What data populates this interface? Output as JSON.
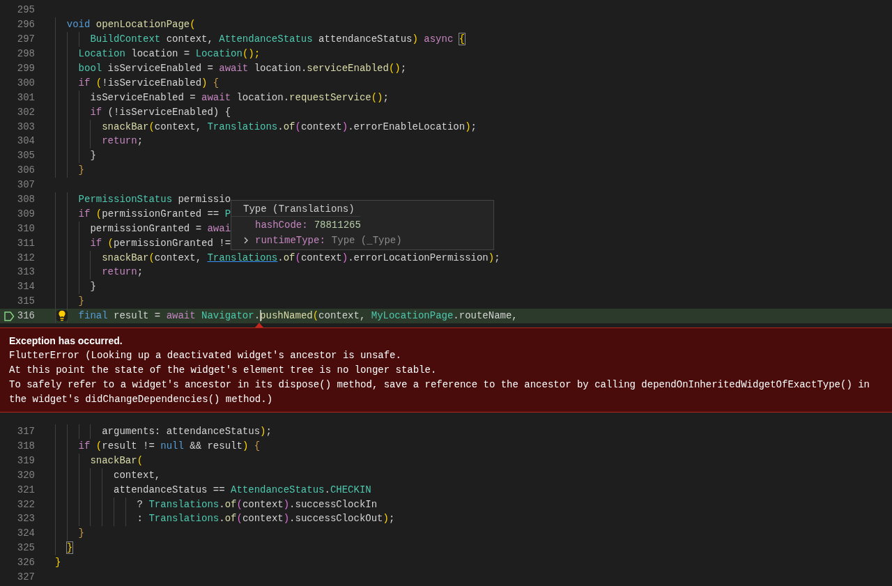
{
  "editor": {
    "lines_before": [
      {
        "number": "295"
      },
      {
        "number": "296",
        "tokens": [
          {
            "text": "  void",
            "kind": "kw"
          },
          {
            "text": " openLocationPage",
            "kind": "fn"
          },
          {
            "text": "(",
            "kind": "gold"
          }
        ]
      },
      {
        "number": "297",
        "tokens": [
          {
            "text": "      BuildContext",
            "kind": "type"
          },
          {
            "text": " context, ",
            "kind": "plain"
          },
          {
            "text": "AttendanceStatus",
            "kind": "type"
          },
          {
            "text": " attendanceStatus",
            "kind": "plain"
          },
          {
            "text": ")",
            "kind": "gold"
          },
          {
            "text": " async",
            "kind": "ctrl"
          },
          {
            "text": " {",
            "kind": "match"
          }
        ]
      },
      {
        "number": "298",
        "tokens": [
          {
            "text": "    Location",
            "kind": "type"
          },
          {
            "text": " location = ",
            "kind": "plain"
          },
          {
            "text": "Location",
            "kind": "type"
          },
          {
            "text": "();",
            "kind": "gold"
          }
        ]
      },
      {
        "number": "299",
        "tokens": [
          {
            "text": "    bool",
            "kind": "type"
          },
          {
            "text": " isServiceEnabled = ",
            "kind": "plain"
          },
          {
            "text": "await",
            "kind": "ctrl"
          },
          {
            "text": " location.",
            "kind": "plain"
          },
          {
            "text": "serviceEnabled",
            "kind": "fn"
          },
          {
            "text": "()",
            "kind": "gold"
          },
          {
            "text": ";",
            "kind": "plain"
          }
        ]
      },
      {
        "number": "300",
        "tokens": [
          {
            "text": "    if",
            "kind": "ctrl"
          },
          {
            "text": " (",
            "kind": "gold"
          },
          {
            "text": "!isServiceEnabled",
            "kind": "plain"
          },
          {
            "text": ")",
            "kind": "gold"
          },
          {
            "text": " {",
            "kind": "dimgold"
          }
        ]
      },
      {
        "number": "301",
        "tokens": [
          {
            "text": "      isServiceEnabled = ",
            "kind": "plain"
          },
          {
            "text": "await",
            "kind": "ctrl"
          },
          {
            "text": " location.",
            "kind": "plain"
          },
          {
            "text": "requestService",
            "kind": "fn"
          },
          {
            "text": "()",
            "kind": "gold"
          },
          {
            "text": ";",
            "kind": "plain"
          }
        ]
      },
      {
        "number": "302",
        "tokens": [
          {
            "text": "      if",
            "kind": "ctrl"
          },
          {
            "text": " (!isServiceEnabled) {",
            "kind": "plain"
          }
        ]
      },
      {
        "number": "303",
        "tokens": [
          {
            "text": "        snackBar",
            "kind": "fn"
          },
          {
            "text": "(",
            "kind": "gold"
          },
          {
            "text": "context, ",
            "kind": "plain"
          },
          {
            "text": "Translations",
            "kind": "type"
          },
          {
            "text": ".",
            "kind": "plain"
          },
          {
            "text": "of",
            "kind": "fn"
          },
          {
            "text": "(",
            "kind": "pink"
          },
          {
            "text": "context",
            "kind": "plain"
          },
          {
            "text": ")",
            "kind": "pink"
          },
          {
            "text": ".errorEnableLocation",
            "kind": "plain"
          },
          {
            "text": ")",
            "kind": "gold"
          },
          {
            "text": ";",
            "kind": "plain"
          }
        ]
      },
      {
        "number": "304",
        "tokens": [
          {
            "text": "        return",
            "kind": "ctrl"
          },
          {
            "text": ";",
            "kind": "plain"
          }
        ]
      },
      {
        "number": "305",
        "tokens": [
          {
            "text": "      }",
            "kind": "plain"
          }
        ]
      },
      {
        "number": "306",
        "tokens": [
          {
            "text": "    }",
            "kind": "dimgold"
          }
        ]
      },
      {
        "number": "307"
      },
      {
        "number": "308",
        "tokens": [
          {
            "text": "    PermissionStatus",
            "kind": "type"
          },
          {
            "text": " permissio",
            "kind": "plain"
          }
        ]
      },
      {
        "number": "309",
        "tokens": [
          {
            "text": "    if",
            "kind": "ctrl"
          },
          {
            "text": " (",
            "kind": "gold"
          },
          {
            "text": "permissionGranted == ",
            "kind": "plain"
          },
          {
            "text": "P",
            "kind": "type"
          }
        ]
      },
      {
        "number": "310",
        "tokens": [
          {
            "text": "      permissionGranted = ",
            "kind": "plain"
          },
          {
            "text": "awai",
            "kind": "ctrl"
          }
        ]
      },
      {
        "number": "311",
        "tokens": [
          {
            "text": "      if",
            "kind": "ctrl"
          },
          {
            "text": " (",
            "kind": "gold"
          },
          {
            "text": "permissionGranted !=",
            "kind": "plain"
          }
        ]
      },
      {
        "number": "312",
        "tokens": [
          {
            "text": "        snackBar",
            "kind": "fn"
          },
          {
            "text": "(",
            "kind": "gold"
          },
          {
            "text": "context, ",
            "kind": "plain"
          },
          {
            "text": "Translations",
            "kind": "link"
          },
          {
            "text": ".",
            "kind": "plain"
          },
          {
            "text": "of",
            "kind": "fn"
          },
          {
            "text": "(",
            "kind": "pink"
          },
          {
            "text": "context",
            "kind": "plain"
          },
          {
            "text": ")",
            "kind": "pink"
          },
          {
            "text": ".errorLocationPermission",
            "kind": "plain"
          },
          {
            "text": ")",
            "kind": "gold"
          },
          {
            "text": ";",
            "kind": "plain"
          }
        ]
      },
      {
        "number": "313",
        "tokens": [
          {
            "text": "        return",
            "kind": "ctrl"
          },
          {
            "text": ";",
            "kind": "plain"
          }
        ]
      },
      {
        "number": "314",
        "tokens": [
          {
            "text": "      }",
            "kind": "plain"
          }
        ]
      },
      {
        "number": "315",
        "tokens": [
          {
            "text": "    }",
            "kind": "dimgold"
          }
        ]
      }
    ],
    "paused_line": {
      "number": "316",
      "tokens": [
        {
          "text": "    final",
          "kind": "kw",
          "caret": false
        },
        {
          "text": " result = ",
          "kind": "plain",
          "caret": false
        },
        {
          "text": "await",
          "kind": "ctrl",
          "caret": false
        },
        {
          "text": " Navigator",
          "kind": "type",
          "caret": false
        },
        {
          "text": ".",
          "kind": "plain",
          "caret": true
        },
        {
          "text": "pushNamed",
          "kind": "fn",
          "caret": false
        },
        {
          "text": "(",
          "kind": "gold",
          "caret": false
        },
        {
          "text": "context, ",
          "kind": "plain",
          "caret": false
        },
        {
          "text": "MyLocationPage",
          "kind": "type",
          "caret": false
        },
        {
          "text": ".routeName,",
          "kind": "plain",
          "caret": false
        }
      ]
    },
    "exception": {
      "title": "Exception has occurred.",
      "message_lines": [
        "FlutterError (Looking up a deactivated widget's ancestor is unsafe.",
        "At this point the state of the widget's element tree is no longer stable.",
        "To safely refer to a widget's ancestor in its dispose() method, save a reference to the ancestor by calling dependOnInheritedWidgetOfExactType() in",
        "the widget's didChangeDependencies() method.)"
      ]
    },
    "lines_after": [
      {
        "number": "317",
        "tokens": [
          {
            "text": "        arguments: attendanceStatus",
            "kind": "plain"
          },
          {
            "text": ")",
            "kind": "gold"
          },
          {
            "text": ";",
            "kind": "plain"
          }
        ]
      },
      {
        "number": "318",
        "tokens": [
          {
            "text": "    if",
            "kind": "ctrl"
          },
          {
            "text": " (",
            "kind": "gold"
          },
          {
            "text": "result != ",
            "kind": "plain"
          },
          {
            "text": "null",
            "kind": "kw"
          },
          {
            "text": " && result",
            "kind": "plain"
          },
          {
            "text": ")",
            "kind": "gold"
          },
          {
            "text": " {",
            "kind": "dimgold"
          }
        ]
      },
      {
        "number": "319",
        "tokens": [
          {
            "text": "      snackBar",
            "kind": "fn"
          },
          {
            "text": "(",
            "kind": "gold"
          }
        ]
      },
      {
        "number": "320",
        "tokens": [
          {
            "text": "          context,",
            "kind": "plain"
          }
        ]
      },
      {
        "number": "321",
        "tokens": [
          {
            "text": "          attendanceStatus == ",
            "kind": "plain"
          },
          {
            "text": "AttendanceStatus",
            "kind": "type"
          },
          {
            "text": ".",
            "kind": "plain"
          },
          {
            "text": "CHECKIN",
            "kind": "type"
          }
        ]
      },
      {
        "number": "322",
        "tokens": [
          {
            "text": "              ? ",
            "kind": "plain"
          },
          {
            "text": "Translations",
            "kind": "type"
          },
          {
            "text": ".",
            "kind": "plain"
          },
          {
            "text": "of",
            "kind": "fn"
          },
          {
            "text": "(",
            "kind": "pink"
          },
          {
            "text": "context",
            "kind": "plain"
          },
          {
            "text": ")",
            "kind": "pink"
          },
          {
            "text": ".successClockIn",
            "kind": "plain"
          }
        ]
      },
      {
        "number": "323",
        "tokens": [
          {
            "text": "              : ",
            "kind": "plain"
          },
          {
            "text": "Translations",
            "kind": "type"
          },
          {
            "text": ".",
            "kind": "plain"
          },
          {
            "text": "of",
            "kind": "fn"
          },
          {
            "text": "(",
            "kind": "pink"
          },
          {
            "text": "context",
            "kind": "plain"
          },
          {
            "text": ")",
            "kind": "pink"
          },
          {
            "text": ".successClockOut",
            "kind": "plain"
          },
          {
            "text": ")",
            "kind": "gold"
          },
          {
            "text": ";",
            "kind": "plain"
          }
        ]
      },
      {
        "number": "324",
        "tokens": [
          {
            "text": "    }",
            "kind": "dimgold"
          }
        ]
      },
      {
        "number": "325",
        "tokens": [
          {
            "text": "  }",
            "kind": "match"
          }
        ]
      },
      {
        "number": "326",
        "tokens": [
          {
            "text": "}",
            "kind": "gold"
          }
        ]
      },
      {
        "number": "327"
      }
    ],
    "hover": {
      "title": "Type (Translations)",
      "fields": [
        {
          "name": "hashCode:",
          "value": "78811265",
          "kind": "number",
          "expandable": false
        },
        {
          "name": "runtimeType:",
          "value": "Type (_Type)",
          "kind": "object",
          "expandable": true
        }
      ]
    }
  }
}
